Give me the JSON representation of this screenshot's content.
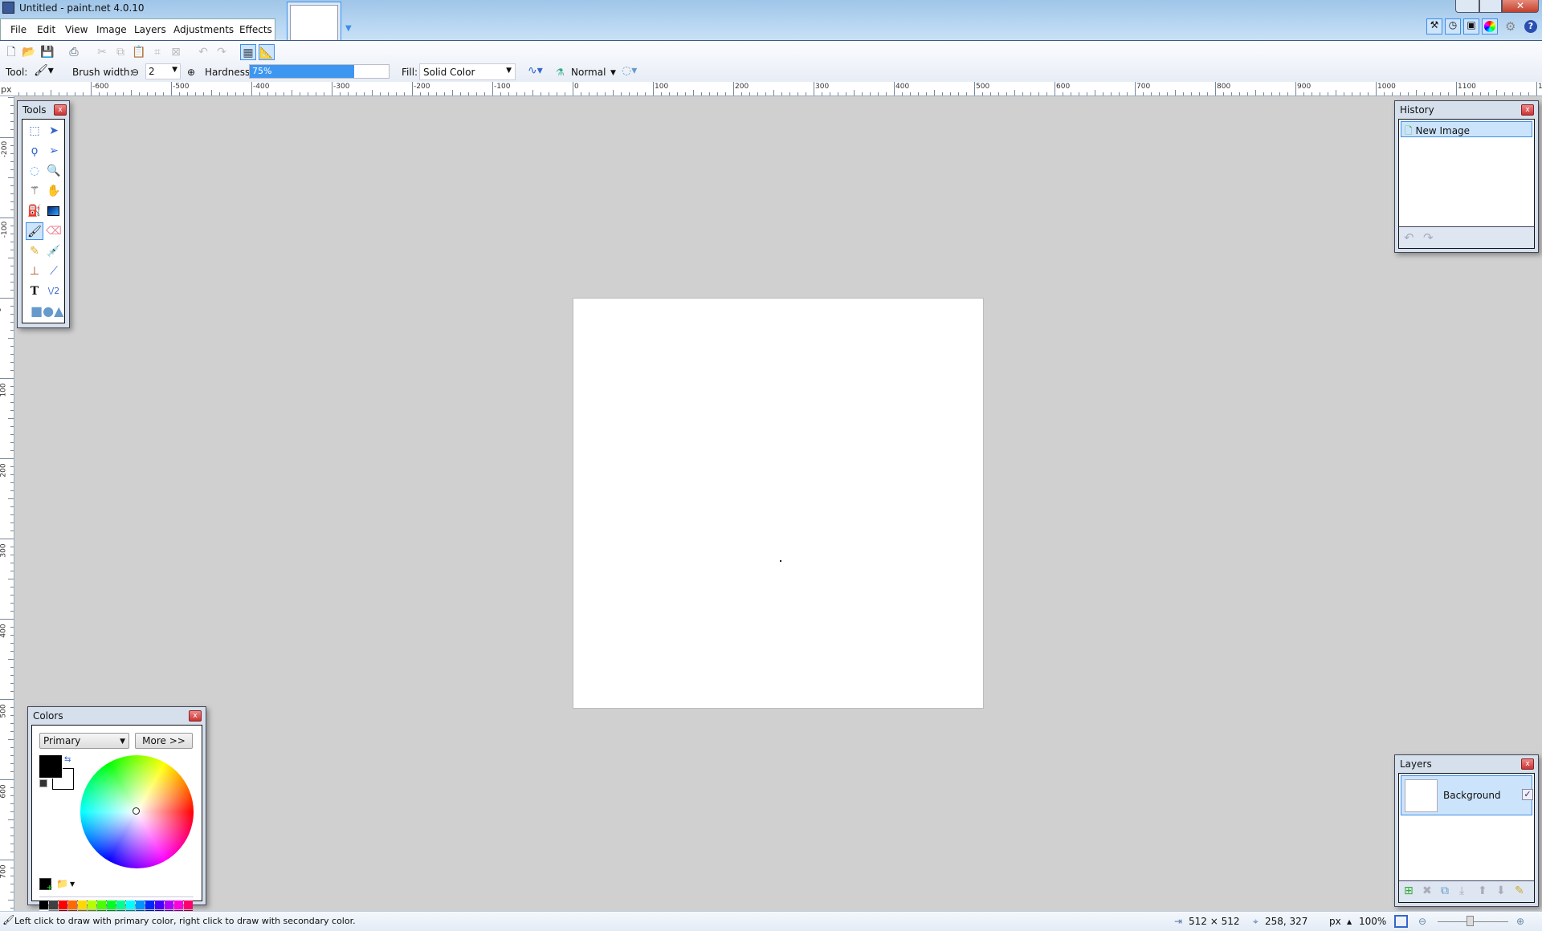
{
  "window": {
    "title": "Untitled - paint.net 4.0.10"
  },
  "menu": [
    "File",
    "Edit",
    "View",
    "Image",
    "Layers",
    "Adjustments",
    "Effects"
  ],
  "tool_options": {
    "tool_label": "Tool:",
    "brush_width_label": "Brush width:",
    "brush_width": "2",
    "hardness_label": "Hardness:",
    "hardness": "75%",
    "hardness_value": 75,
    "fill_label": "Fill:",
    "fill": "Solid Color",
    "blend_mode": "Normal"
  },
  "ruler": {
    "unit": "px"
  },
  "tools_window": {
    "title": "Tools",
    "tools": [
      "rectangle-select",
      "move-selected-pixels",
      "lasso-select",
      "move-selection",
      "ellipse-select",
      "zoom",
      "magic-wand",
      "pan",
      "paint-bucket",
      "gradient",
      "paintbrush",
      "eraser",
      "pencil",
      "color-picker",
      "clone-stamp",
      "recolor",
      "text",
      "line-curve",
      "shapes"
    ],
    "active": "paintbrush"
  },
  "history_window": {
    "title": "History",
    "items": [
      "New Image"
    ]
  },
  "layers_window": {
    "title": "Layers",
    "layers": [
      {
        "name": "Background",
        "visible": true
      }
    ]
  },
  "colors_window": {
    "title": "Colors",
    "mode": "Primary",
    "more_label": "More >>",
    "primary": "#000000",
    "secondary": "#ffffff",
    "palette_top": [
      "#000000",
      "#404040",
      "#ff0000",
      "#ff6a00",
      "#ffd800",
      "#b6ff00",
      "#4cff00",
      "#00ff21",
      "#00ff90",
      "#00ffff",
      "#0094ff",
      "#0026ff",
      "#4800ff",
      "#b200ff",
      "#ff00dc",
      "#ff006e"
    ],
    "palette_bottom": [
      "#ffffff",
      "#808080",
      "#7f0000",
      "#7f3300",
      "#7f6a00",
      "#5b7f00",
      "#267f00",
      "#007f0e",
      "#007f46",
      "#007f7f",
      "#004a7f",
      "#00137f",
      "#21007f",
      "#57007f",
      "#7f006e",
      "#7f0037"
    ]
  },
  "status": {
    "hint": "Left click to draw with primary color, right click to draw with secondary color.",
    "image_size": "512 × 512",
    "cursor": "258, 327",
    "unit": "px",
    "zoom": "100%"
  }
}
